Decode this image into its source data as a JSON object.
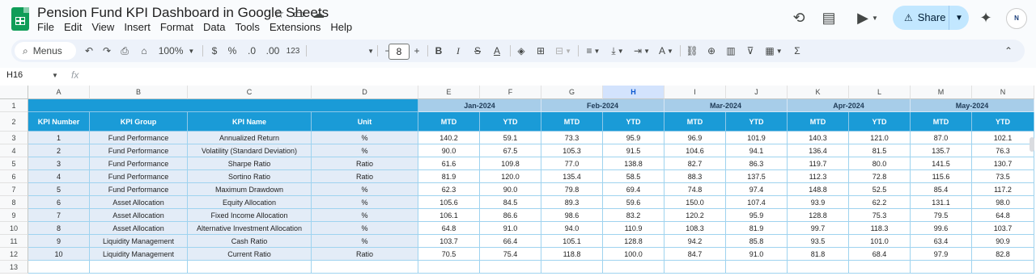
{
  "app": {
    "doc_title": "Pension Fund KPI Dashboard in Google Sheets",
    "menus": [
      "File",
      "Edit",
      "View",
      "Insert",
      "Format",
      "Data",
      "Tools",
      "Extensions",
      "Help"
    ],
    "share_label": "Share",
    "avatar_text": "N"
  },
  "toolbar": {
    "menus_label": "Menus",
    "zoom": "100%",
    "currency": "$",
    "percent": "%",
    "decrease_decimal": ".0",
    "increase_decimal": ".00",
    "number_format": "123",
    "font_size": "8",
    "bold": "B",
    "italic": "I",
    "strike": "S",
    "text_color": "A",
    "function_symbol": "Σ"
  },
  "formula_bar": {
    "name_box": "H16",
    "fx": "fx",
    "value": ""
  },
  "columns": [
    "A",
    "B",
    "C",
    "D",
    "E",
    "F",
    "G",
    "H",
    "I",
    "J",
    "K",
    "L",
    "M",
    "N"
  ],
  "selected_column": "H",
  "rows": [
    "1",
    "2",
    "3",
    "4",
    "5",
    "6",
    "7",
    "8",
    "9",
    "10",
    "11",
    "12",
    "13"
  ],
  "sheet": {
    "headers": [
      "KPI Number",
      "KPI Group",
      "KPI Name",
      "Unit"
    ],
    "months": [
      "Jan-2024",
      "Feb-2024",
      "Mar-2024",
      "Apr-2024",
      "May-2024"
    ],
    "sub_headers": [
      "MTD",
      "YTD"
    ],
    "data": [
      [
        "1",
        "Fund Performance",
        "Annualized Return",
        "%",
        "140.2",
        "59.1",
        "73.3",
        "95.9",
        "96.9",
        "101.9",
        "140.3",
        "121.0",
        "87.0",
        "102.1"
      ],
      [
        "2",
        "Fund Performance",
        "Volatility (Standard Deviation)",
        "%",
        "90.0",
        "67.5",
        "105.3",
        "91.5",
        "104.6",
        "94.1",
        "136.4",
        "81.5",
        "135.7",
        "76.3"
      ],
      [
        "3",
        "Fund Performance",
        "Sharpe Ratio",
        "Ratio",
        "61.6",
        "109.8",
        "77.0",
        "138.8",
        "82.7",
        "86.3",
        "119.7",
        "80.0",
        "141.5",
        "130.7"
      ],
      [
        "4",
        "Fund Performance",
        "Sortino Ratio",
        "Ratio",
        "81.9",
        "120.0",
        "135.4",
        "58.5",
        "88.3",
        "137.5",
        "112.3",
        "72.8",
        "115.6",
        "73.5"
      ],
      [
        "5",
        "Fund Performance",
        "Maximum Drawdown",
        "%",
        "62.3",
        "90.0",
        "79.8",
        "69.4",
        "74.8",
        "97.4",
        "148.8",
        "52.5",
        "85.4",
        "117.2"
      ],
      [
        "6",
        "Asset Allocation",
        "Equity Allocation",
        "%",
        "105.6",
        "84.5",
        "89.3",
        "59.6",
        "150.0",
        "107.4",
        "93.9",
        "62.2",
        "131.1",
        "98.0"
      ],
      [
        "7",
        "Asset Allocation",
        "Fixed Income Allocation",
        "%",
        "106.1",
        "86.6",
        "98.6",
        "83.2",
        "120.2",
        "95.9",
        "128.8",
        "75.3",
        "79.5",
        "64.8"
      ],
      [
        "8",
        "Asset Allocation",
        "Alternative Investment Allocation",
        "%",
        "64.8",
        "91.0",
        "94.0",
        "110.9",
        "108.3",
        "81.9",
        "99.7",
        "118.3",
        "99.6",
        "103.7"
      ],
      [
        "9",
        "Liquidity Management",
        "Cash Ratio",
        "%",
        "103.7",
        "66.4",
        "105.1",
        "128.8",
        "94.2",
        "85.8",
        "93.5",
        "101.0",
        "63.4",
        "90.9"
      ],
      [
        "10",
        "Liquidity Management",
        "Current Ratio",
        "Ratio",
        "70.5",
        "75.4",
        "118.8",
        "100.0",
        "84.7",
        "91.0",
        "81.8",
        "68.4",
        "97.9",
        "82.8"
      ]
    ]
  }
}
